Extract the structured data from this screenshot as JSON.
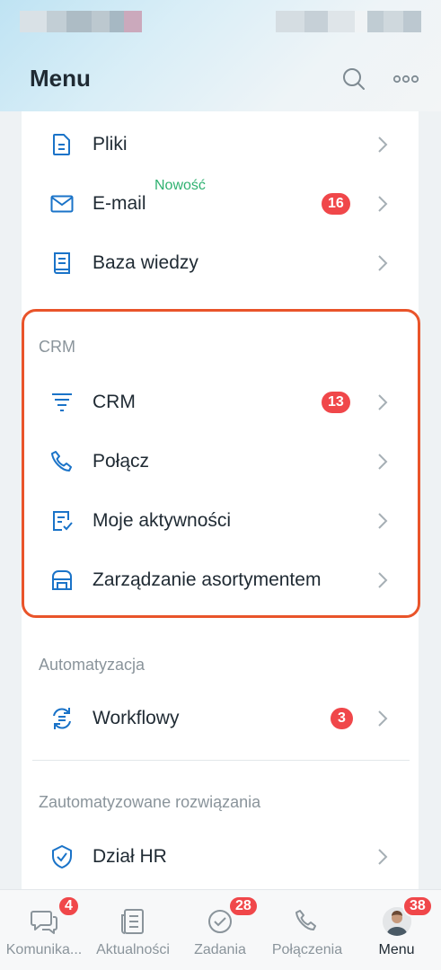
{
  "header": {
    "title": "Menu",
    "search_icon": "search-icon",
    "more_icon": "more-dots-icon"
  },
  "status_bar": {
    "left_blur_colors": [
      "#d7dfe4",
      "#bfcbd3",
      "#a7b7c1",
      "#b9c6ce",
      "#9fb3bf",
      "#c9a8bb"
    ],
    "right_blur_colors": [
      "#d5dde2",
      "#c4cfd6",
      "#dfe5e9",
      "#b8c5cd",
      "#cfd8dd",
      "#bcc8d0"
    ]
  },
  "colors": {
    "accent_blue": "#1a73c8",
    "badge_red": "#f0474a",
    "new_green": "#2fb170",
    "highlight_orange": "#e9542a"
  },
  "menu": {
    "items_top": [
      {
        "label": "Pliki",
        "icon": "file-icon"
      },
      {
        "label": "E-mail",
        "icon": "mail-icon",
        "tag": "Nowość",
        "badge": "16"
      },
      {
        "label": "Baza wiedzy",
        "icon": "book-icon"
      }
    ],
    "crm_section": {
      "title": "CRM",
      "items": [
        {
          "label": "CRM",
          "icon": "funnel-icon",
          "badge": "13"
        },
        {
          "label": "Połącz",
          "icon": "phone-icon"
        },
        {
          "label": "Moje aktywności",
          "icon": "activity-list-icon"
        },
        {
          "label": "Zarządzanie asortymentem",
          "icon": "store-icon"
        }
      ]
    },
    "automation_section": {
      "title": "Automatyzacja",
      "items": [
        {
          "label": "Workflowy",
          "icon": "workflow-cycle-icon",
          "badge": "3"
        }
      ]
    },
    "solutions_section": {
      "title": "Zautomatyzowane rozwiązania",
      "items": [
        {
          "label": "Dział HR",
          "icon": "shield-check-icon"
        }
      ]
    }
  },
  "bottom_nav": [
    {
      "label": "Komunika...",
      "icon": "chat-icon",
      "badge": "4"
    },
    {
      "label": "Aktualności",
      "icon": "news-icon"
    },
    {
      "label": "Zadania",
      "icon": "task-check-icon",
      "badge": "28"
    },
    {
      "label": "Połączenia",
      "icon": "phone-icon"
    },
    {
      "label": "Menu",
      "icon": "avatar",
      "badge": "38",
      "active": true
    }
  ]
}
